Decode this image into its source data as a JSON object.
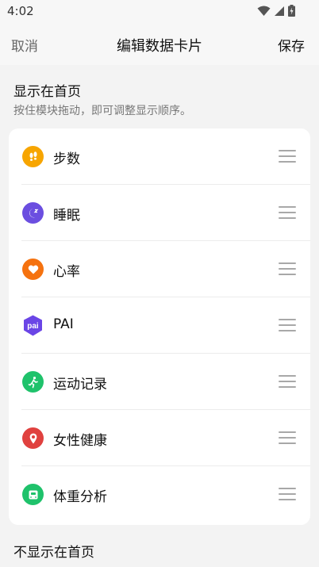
{
  "status_bar": {
    "time": "4:02"
  },
  "nav": {
    "cancel_label": "取消",
    "title": "编辑数据卡片",
    "save_label": "保存"
  },
  "shown_section": {
    "title": "显示在首页",
    "subtitle": "按住模块拖动，即可调整显示顺序。",
    "items": [
      {
        "label": "步数",
        "icon": "footsteps-icon",
        "color": "#f7a500"
      },
      {
        "label": "睡眠",
        "icon": "moon-icon",
        "color": "#6b4ee0"
      },
      {
        "label": "心率",
        "icon": "heart-icon",
        "color": "#f5720f"
      },
      {
        "label": "PAI",
        "icon": "pai-icon",
        "color": "#6a45e6",
        "icon_text": "pai"
      },
      {
        "label": "运动记录",
        "icon": "running-icon",
        "color": "#1fc26b"
      },
      {
        "label": "女性健康",
        "icon": "female-health-icon",
        "color": "#e0413f"
      },
      {
        "label": "体重分析",
        "icon": "scale-icon",
        "color": "#1fc26b"
      }
    ]
  },
  "hidden_section": {
    "title": "不显示在首页"
  }
}
